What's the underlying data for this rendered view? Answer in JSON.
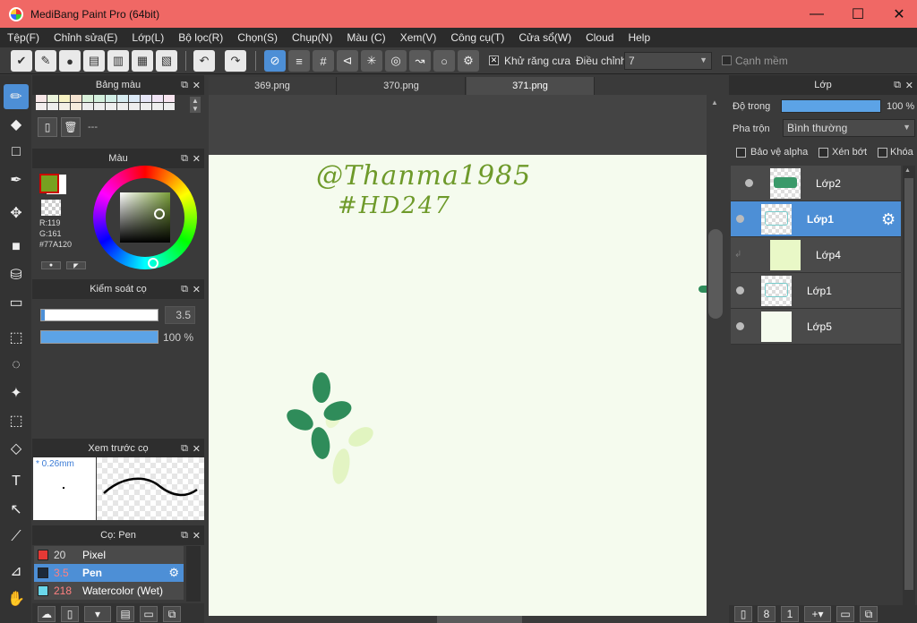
{
  "window": {
    "title": "MediBang Paint Pro (64bit)",
    "minimize": "—",
    "maximize": "☐",
    "close": "✕"
  },
  "menu": [
    "Tệp(F)",
    "Chỉnh sửa(E)",
    "Lớp(L)",
    "Bộ lọc(R)",
    "Chọn(S)",
    "Chụp(N)",
    "Màu (C)",
    "Xem(V)",
    "Công cụ(T)",
    "Cửa sổ(W)",
    "Cloud",
    "Help"
  ],
  "toolbar": {
    "antialias_label": "Khử răng cưa",
    "correction_label": "Điều chỉnh",
    "correction_value": "7",
    "soft_edge_label": "Cạnh mềm"
  },
  "palette_panel": {
    "title": "Bảng màu",
    "name": "---"
  },
  "color_panel": {
    "title": "Màu",
    "r": "R:119",
    "g": "G:161",
    "hex": "#77A120",
    "fg_color": "#77A120"
  },
  "brush_control": {
    "title": "Kiểm soát cọ",
    "size": "3.5",
    "opacity": "100 %",
    "size_fraction": 0.03,
    "opacity_fraction": 1.0
  },
  "brush_preview": {
    "title": "Xem trước cọ",
    "size": "* 0.26mm"
  },
  "brush_list": {
    "title": "Cọ: Pen",
    "items": [
      {
        "size": "20",
        "name": "Pixel",
        "color": "#e53935",
        "selected": false
      },
      {
        "size": "3.5",
        "name": "Pen",
        "color": "#1c2a3a",
        "selected": true
      },
      {
        "size": "218",
        "name": "Watercolor (Wet)",
        "color": "#6ad7ea",
        "selected": false
      }
    ]
  },
  "tabs": [
    "369.png",
    "370.png",
    "371.png"
  ],
  "active_tab": "371.png",
  "canvas": {
    "handwriting_line1": "@Thanma1985",
    "handwriting_line2": "#HD247"
  },
  "layer_panel": {
    "title": "Lớp",
    "opacity_label": "Độ trong",
    "opacity_value": "100 %",
    "blend_label": "Pha trộn",
    "blend_value": "Bình thường",
    "protect_alpha": "Bảo vệ alpha",
    "clip": "Xén bớt",
    "lock": "Khóa",
    "layers": [
      {
        "name": "Lớp2",
        "selected": false
      },
      {
        "name": "Lớp1",
        "selected": true
      },
      {
        "name": "Lớp4",
        "selected": false
      },
      {
        "name": "Lớp1",
        "selected": false
      },
      {
        "name": "Lớp5",
        "selected": false
      }
    ]
  }
}
